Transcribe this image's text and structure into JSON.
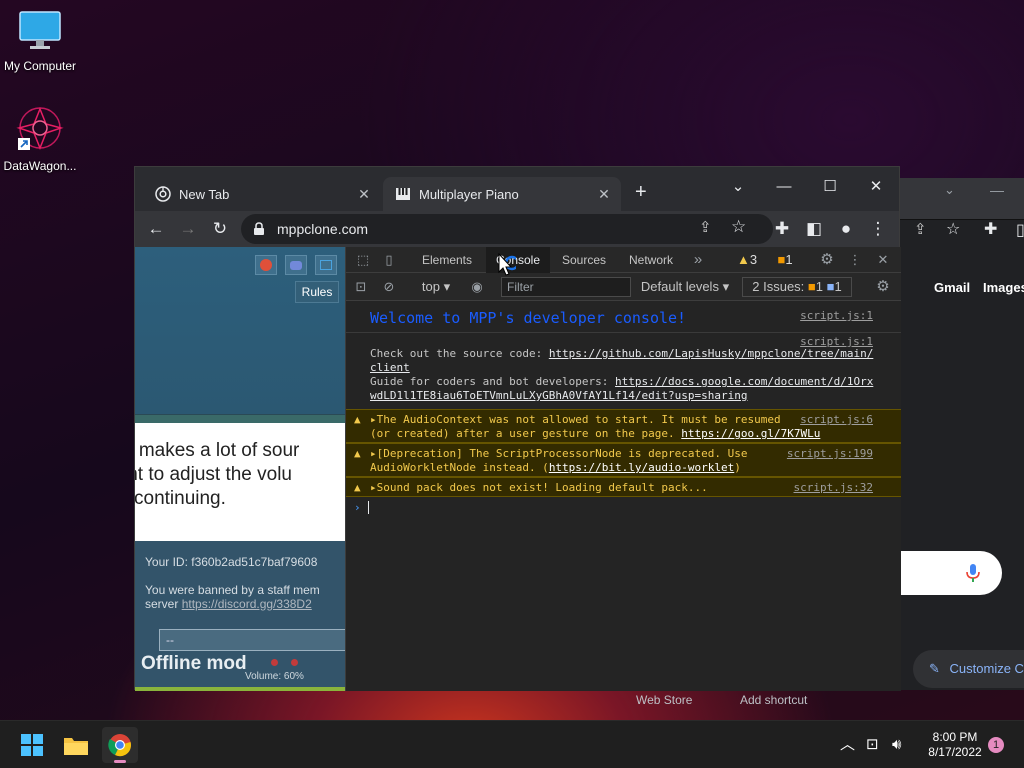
{
  "desktop": {
    "icons": [
      {
        "label": "My Computer"
      },
      {
        "label": "DataWagon..."
      }
    ]
  },
  "browser": {
    "tabs": [
      {
        "title": "New Tab",
        "active": false
      },
      {
        "title": "Multiplayer Piano",
        "active": true
      }
    ],
    "new_tab_symbol": "+",
    "address": "mppclone.com"
  },
  "page": {
    "rules_label": "Rules",
    "modal_lines": [
      "e makes a lot of sour",
      "int to adjust the volu",
      "continuing."
    ],
    "your_id": "Your ID: f360b2ad51c7baf79608",
    "banned_lines": [
      "You were banned by a staff mem",
      "server"
    ],
    "banned_link": "https://discord.gg/338D2",
    "select_value": "--",
    "offline_mode": "Offline mod",
    "volume": "Volume: 60%"
  },
  "back_window": {
    "links": [
      "Gmail",
      "Images"
    ],
    "customize_label": "Customize C",
    "shortcuts": [
      "Web Store",
      "Add shortcut"
    ]
  },
  "devtools": {
    "tabs": [
      "Elements",
      "Console",
      "Sources",
      "Network"
    ],
    "more_tabs": "»",
    "warning_count": "3",
    "issue_count": "1",
    "context": "top",
    "filter_placeholder": "Filter",
    "levels": "Default levels",
    "issues_label": "2 Issues:",
    "issues_warn": "1",
    "issues_info": "1",
    "messages": {
      "welcome": "Welcome to MPP's developer console!",
      "welcome_src": "script.js:1",
      "info_src": "script.js:1",
      "source_prefix": "Check out the source code: ",
      "source_link_1": "https://github.com/LapisHusky/mppclone/tree/main/",
      "source_link_2": "client",
      "guide_prefix": "Guide for coders and bot developers: ",
      "guide_link_1": "https://docs.google.com/document/d/1Orx",
      "guide_link_2": "wdLD1l1TE8iau6ToETVmnLuLXyGBhA0VfAY1Lf14/edit?usp=sharing",
      "warn1_line1": "The AudioContext was not allowed to start. It must be resumed",
      "warn1_line2": "(or created) after a user gesture on the page. ",
      "warn1_link": "https://goo.gl/7K7WLu",
      "warn1_src": "script.js:6",
      "warn2_line1": "[Deprecation] The ScriptProcessorNode is deprecated. Use",
      "warn2_line2": "AudioWorkletNode instead. (",
      "warn2_link": "https://bit.ly/audio-worklet",
      "warn2_close": ")",
      "warn2_src": "script.js:199",
      "warn3": "Sound pack does not exist! Loading default pack...",
      "warn3_src": "script.js:32"
    }
  },
  "taskbar": {
    "time": "8:00 PM",
    "date": "8/17/2022",
    "notification_count": "1"
  },
  "colors": {
    "accent_blue": "#8ab4f8",
    "warning_yellow": "#f2c94c",
    "console_welcome": "#1a5cff"
  }
}
